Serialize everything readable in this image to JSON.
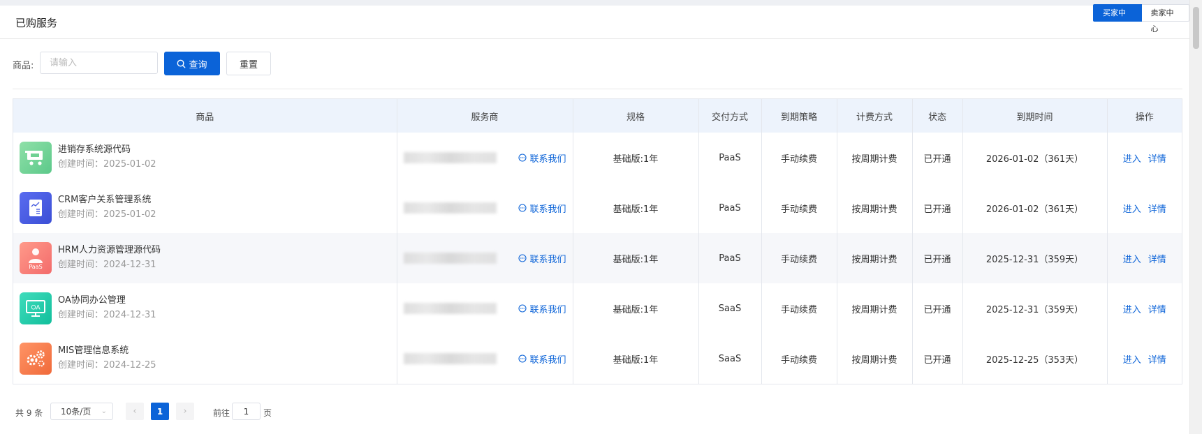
{
  "header": {
    "title": "已购服务",
    "buyer_center": "买家中心",
    "seller_center": "卖家中心"
  },
  "filter": {
    "label": "商品:",
    "placeholder": "请输入",
    "query_label": "查询",
    "reset_label": "重置"
  },
  "table": {
    "columns": [
      "商品",
      "服务商",
      "规格",
      "交付方式",
      "到期策略",
      "计费方式",
      "状态",
      "到期时间",
      "操作"
    ],
    "rows": [
      {
        "name": "进销存系统源代码",
        "created": "创建时间：2025-01-02",
        "icon": "cart-icon",
        "color": "#7fd69c",
        "contact": "联系我们",
        "spec": "基础版:1年",
        "delivery": "PaaS",
        "policy": "手动续费",
        "billing": "按周期计费",
        "status": "已开通",
        "expiry": "2026-01-02（361天）",
        "enter": "进入",
        "detail": "详情"
      },
      {
        "name": "CRM客户关系管理系统",
        "created": "创建时间：2025-01-02",
        "icon": "document-icon",
        "color": "#4a5fe0",
        "contact": "联系我们",
        "spec": "基础版:1年",
        "delivery": "PaaS",
        "policy": "手动续费",
        "billing": "按周期计费",
        "status": "已开通",
        "expiry": "2026-01-02（361天）",
        "enter": "进入",
        "detail": "详情"
      },
      {
        "name": "HRM人力资源管理源代码",
        "created": "创建时间：2024-12-31",
        "icon": "person-icon",
        "color": "#f57c7c",
        "icon_label": "PaaS",
        "contact": "联系我们",
        "spec": "基础版:1年",
        "delivery": "PaaS",
        "policy": "手动续费",
        "billing": "按周期计费",
        "status": "已开通",
        "expiry": "2025-12-31（359天）",
        "enter": "进入",
        "detail": "详情"
      },
      {
        "name": "OA协同办公管理",
        "created": "创建时间：2024-12-31",
        "icon": "monitor-icon",
        "color": "#1fc9a6",
        "icon_label": "OA",
        "contact": "联系我们",
        "spec": "基础版:1年",
        "delivery": "SaaS",
        "policy": "手动续费",
        "billing": "按周期计费",
        "status": "已开通",
        "expiry": "2025-12-31（359天）",
        "enter": "进入",
        "detail": "详情"
      },
      {
        "name": "MIS管理信息系统",
        "created": "创建时间：2024-12-25",
        "icon": "gears-icon",
        "color": "#f47a4a",
        "contact": "联系我们",
        "spec": "基础版:1年",
        "delivery": "SaaS",
        "policy": "手动续费",
        "billing": "按周期计费",
        "status": "已开通",
        "expiry": "2025-12-25（353天）",
        "enter": "进入",
        "detail": "详情"
      }
    ]
  },
  "pagination": {
    "total": "共 9 条",
    "page_size": "10条/页",
    "current_page": "1",
    "goto_label": "前往",
    "goto_value": "1",
    "goto_unit": "页"
  }
}
